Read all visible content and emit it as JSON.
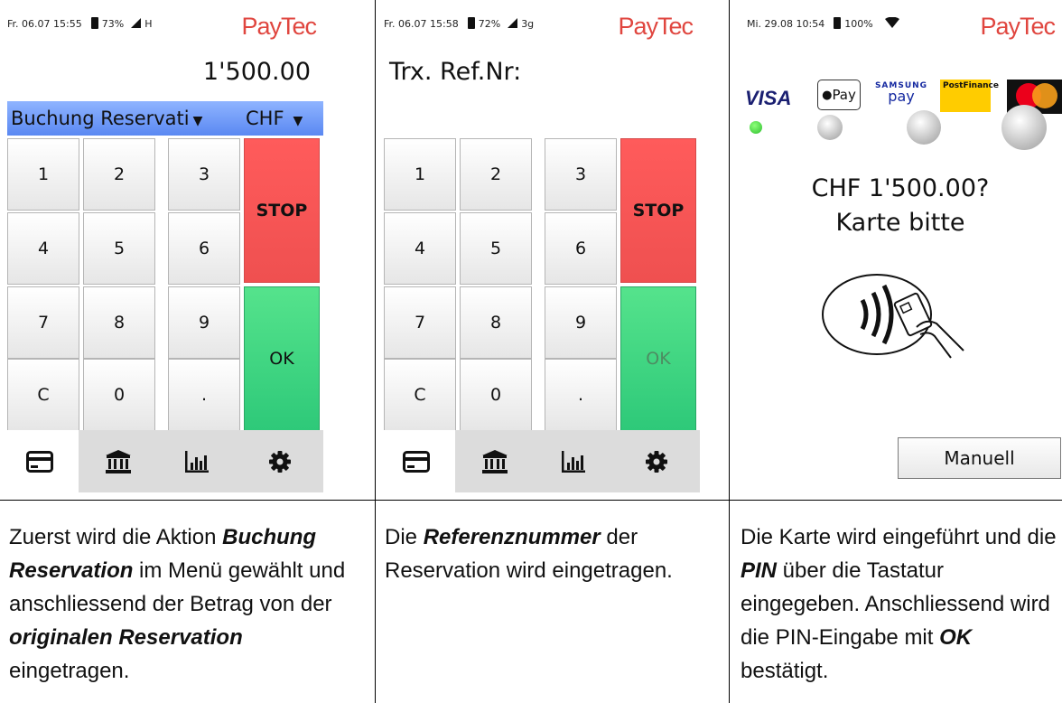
{
  "screen1": {
    "status": {
      "date": "Fr. 06.07 15:55",
      "battery": "73%",
      "network": "H"
    },
    "logo": "PayTec",
    "amount": "1'500.00",
    "dropdown_label": "Buchung Reservati",
    "currency": "CHF",
    "keys": [
      "1",
      "2",
      "3",
      "4",
      "5",
      "6",
      "7",
      "8",
      "9",
      "C",
      "0",
      "."
    ],
    "stop_label": "STOP",
    "ok_label": "OK"
  },
  "screen2": {
    "status": {
      "date": "Fr. 06.07 15:58",
      "battery": "72%",
      "network": "3g"
    },
    "logo": "PayTec",
    "trx_label": "Trx. Ref.Nr:",
    "keys": [
      "1",
      "2",
      "3",
      "4",
      "5",
      "6",
      "7",
      "8",
      "9",
      "C",
      "0",
      "."
    ],
    "stop_label": "STOP",
    "ok_label": "OK"
  },
  "screen3": {
    "status": {
      "date": "Mi. 29.08 10:54",
      "battery": "100%"
    },
    "logo": "PayTec",
    "payment_methods": {
      "visa": "VISA",
      "applepay": "Pay",
      "samsung_top": "SAMSUNG",
      "samsung_bottom": "pay",
      "postfinance": "PostFinance"
    },
    "prompt_amount": "CHF 1'500.00?",
    "prompt_text": "Karte bitte",
    "manual_label": "Manuell"
  },
  "tabs": [
    "card-icon",
    "bank-icon",
    "chart-icon",
    "gear-icon"
  ],
  "captions": {
    "c1": {
      "t1": "Zuerst wird die Aktion ",
      "b1": "Buchung Reservation",
      "t2": " im Menü gewählt und anschliessend der Betrag von der ",
      "b2": "originalen Reservation",
      "t3": " eingetragen."
    },
    "c2": {
      "t1": "Die ",
      "b1": "Referenznummer",
      "t2": " der Reservation wird eingetragen."
    },
    "c3": {
      "t1": "Die Karte wird eingeführt und die ",
      "b1": "PIN",
      "t2": " über die Tastatur eingegeben. Anschliessend wird die PIN-Eingabe mit ",
      "b2": "OK",
      "t3": " bestätigt."
    }
  },
  "colors": {
    "stop": "#ef5050",
    "ok": "#2ec979",
    "dropdown": "#6f97f6",
    "logo": "#e0463f"
  }
}
